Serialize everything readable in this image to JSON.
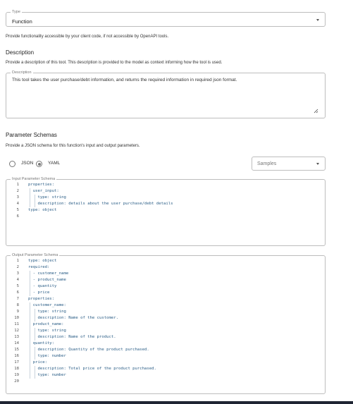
{
  "type_select": {
    "legend": "Type",
    "value": "Function"
  },
  "type_help": "Provide functionality accessible by your client code, if not accessible by OpenAPI tools.",
  "description": {
    "heading": "Description",
    "help": "Provide a description of this tool. This description is provided to the model as context informing how the tool is used.",
    "legend": "Description",
    "value": "This tool takes the user purchase/debt information, and returns the required information in required json format."
  },
  "parameter_schemas": {
    "heading": "Parameter Schemas",
    "help": "Provide a JSON schema for this function's input and output parameters.",
    "format_options": [
      {
        "label": "JSON",
        "selected": false
      },
      {
        "label": "YAML",
        "selected": true
      }
    ],
    "samples_placeholder": "Samples"
  },
  "input_schema": {
    "legend": "Input Parameter Schema",
    "lines": [
      {
        "n": "1",
        "text": "properties:"
      },
      {
        "n": "2",
        "text": "  user_input:"
      },
      {
        "n": "3",
        "text": "    type: string"
      },
      {
        "n": "4",
        "text": "    description: details about the user purchase/debt details"
      },
      {
        "n": "5",
        "text": "type: object"
      },
      {
        "n": "6",
        "text": ""
      }
    ]
  },
  "output_schema": {
    "legend": "Output Parameter Schema",
    "lines": [
      {
        "n": "1",
        "text": "type: object"
      },
      {
        "n": "2",
        "text": "required:"
      },
      {
        "n": "3",
        "text": "  - customer_name"
      },
      {
        "n": "4",
        "text": "  - product_name"
      },
      {
        "n": "5",
        "text": "  - quantity"
      },
      {
        "n": "6",
        "text": "  - price"
      },
      {
        "n": "7",
        "text": "properties:"
      },
      {
        "n": "8",
        "text": "  customer_name:"
      },
      {
        "n": "9",
        "text": "    type: string"
      },
      {
        "n": "10",
        "text": "    description: Name of the customer."
      },
      {
        "n": "11",
        "text": "  product_name:"
      },
      {
        "n": "12",
        "text": "    type: string"
      },
      {
        "n": "13",
        "text": "    description: Name of the product."
      },
      {
        "n": "14",
        "text": "  quantity:"
      },
      {
        "n": "15",
        "text": "    description: Quantity of the product purchased."
      },
      {
        "n": "16",
        "text": "    type: number"
      },
      {
        "n": "17",
        "text": "  price:"
      },
      {
        "n": "18",
        "text": "    description: Total price of the product purchased."
      },
      {
        "n": "19",
        "text": "    type: number"
      },
      {
        "n": "20",
        "text": ""
      }
    ]
  }
}
